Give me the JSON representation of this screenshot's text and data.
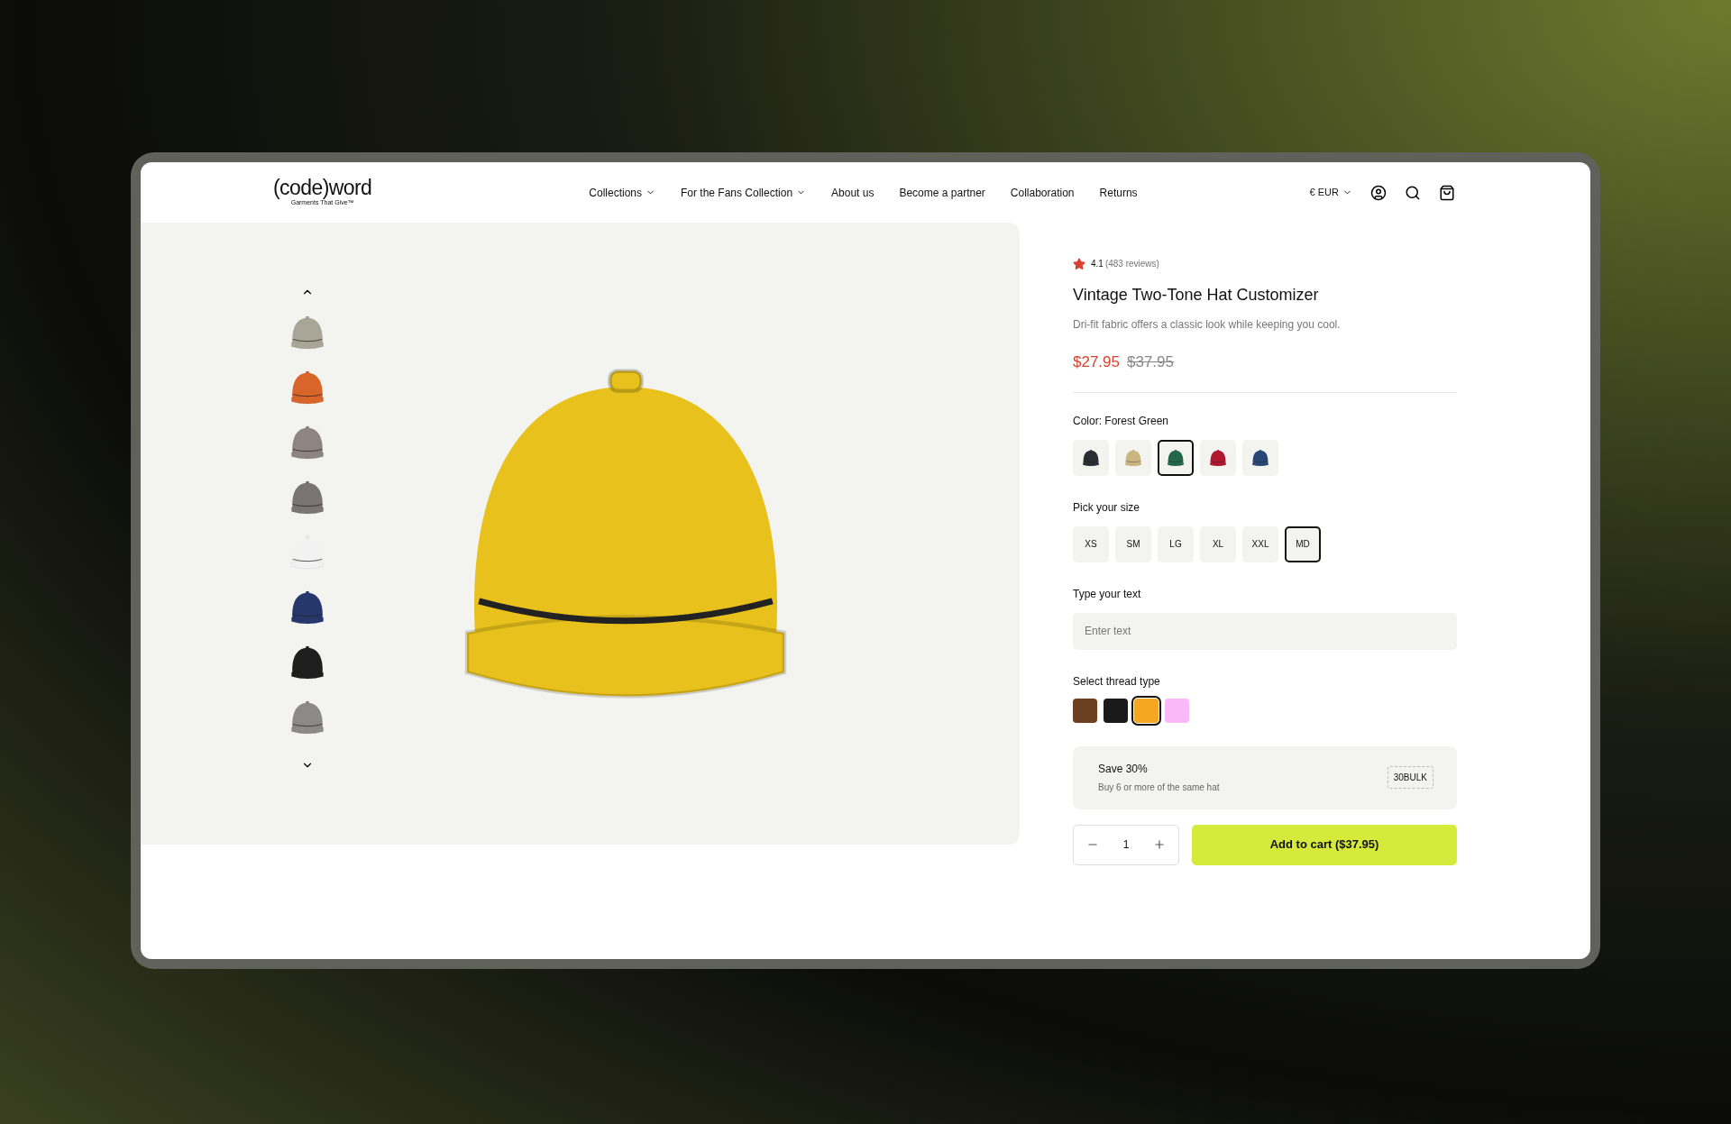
{
  "header": {
    "logo": "(code)word",
    "tagline": "Garments That Give™",
    "nav": [
      {
        "label": "Collections",
        "dropdown": true
      },
      {
        "label": "For the Fans Collection",
        "dropdown": true
      },
      {
        "label": "About us",
        "dropdown": false
      },
      {
        "label": "Become a partner",
        "dropdown": false
      },
      {
        "label": "Collaboration",
        "dropdown": false
      },
      {
        "label": "Returns",
        "dropdown": false
      }
    ],
    "currency": "€ EUR"
  },
  "gallery": {
    "thumbnails": [
      {
        "color": "#a9a597"
      },
      {
        "color": "#d9652a"
      },
      {
        "color": "#8f8580"
      },
      {
        "color": "#7a7472"
      },
      {
        "color": "#f2f2f2"
      },
      {
        "color": "#26386b"
      },
      {
        "color": "#1e1e1e"
      },
      {
        "color": "#8c8a88"
      }
    ]
  },
  "product": {
    "rating": "4.1",
    "reviews": "(483 reviews)",
    "title": "Vintage Two-Tone Hat Customizer",
    "description": "Dri-fit fabric offers a classic look while keeping you cool.",
    "price": "$27.95",
    "compare_price": "$37.95",
    "color_label": "Color: Forest Green",
    "colors": [
      {
        "color": "#2b2d33",
        "selected": false
      },
      {
        "color": "#c9b681",
        "selected": false
      },
      {
        "color": "#23684a",
        "selected": true
      },
      {
        "color": "#b0182f",
        "selected": false
      },
      {
        "color": "#2a4675",
        "selected": false
      }
    ],
    "size_label": "Pick your size",
    "sizes": [
      {
        "label": "XS",
        "selected": false
      },
      {
        "label": "SM",
        "selected": false
      },
      {
        "label": "LG",
        "selected": false
      },
      {
        "label": "XL",
        "selected": false
      },
      {
        "label": "XXL",
        "selected": false
      },
      {
        "label": "MD",
        "selected": true
      }
    ],
    "text_label": "Type your text",
    "text_placeholder": "Enter text",
    "thread_label": "Select thread type",
    "threads": [
      {
        "color": "#6b3f1f",
        "selected": false
      },
      {
        "color": "#1a1a1a",
        "selected": false
      },
      {
        "color": "#f5a623",
        "selected": true
      },
      {
        "color": "#f9b8f7",
        "selected": false
      }
    ],
    "offer": {
      "title": "Save 30%",
      "subtitle": "Buy 6 or more of the same hat",
      "code": "30BULK"
    },
    "quantity": "1",
    "add_to_cart": "Add to cart ($37.95)"
  }
}
